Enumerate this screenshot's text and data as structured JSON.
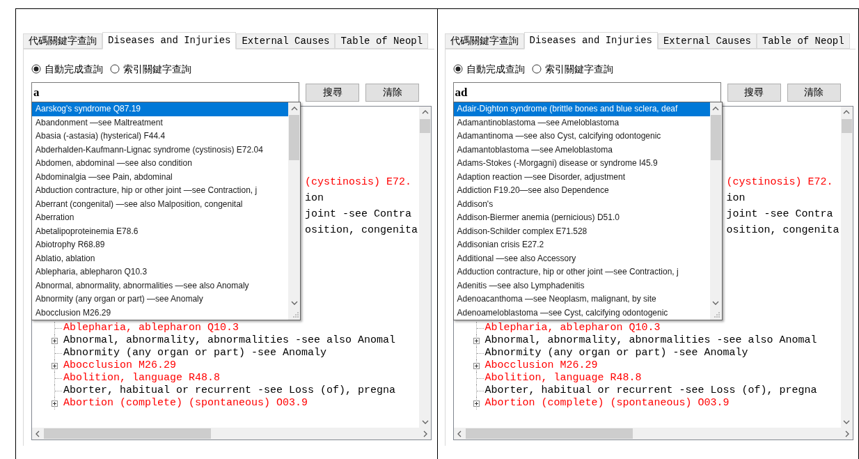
{
  "panels": [
    {
      "tabs": [
        {
          "label": "代碼關鍵字查詢",
          "selected": false
        },
        {
          "label": "Diseases and Injuries",
          "selected": true
        },
        {
          "label": "External Causes",
          "selected": false
        },
        {
          "label": "Table of Neopl",
          "selected": false
        }
      ],
      "radios": [
        {
          "label": "自動完成查詢",
          "selected": true
        },
        {
          "label": "索引關鍵字查詢",
          "selected": false
        }
      ],
      "search": {
        "value": "a"
      },
      "buttons": [
        "搜尋",
        "清除"
      ],
      "suggestions": [
        {
          "text": "Aarskog's syndrome  Q87.19",
          "selected": true
        },
        {
          "text": "Abandonment  —see Maltreatment",
          "selected": false
        },
        {
          "text": "Abasia (-astasia) (hysterical) F44.4",
          "selected": false
        },
        {
          "text": "Abderhalden-Kaufmann-Lignac syndrome (cystinosis) E72.04",
          "selected": false
        },
        {
          "text": "Abdomen, abdominal  —see also condition",
          "selected": false
        },
        {
          "text": "Abdominalgia  —see Pain, abdominal",
          "selected": false
        },
        {
          "text": "Abduction contracture, hip or other joint  —see Contraction, j",
          "selected": false
        },
        {
          "text": "Aberrant (congenital) —see also Malposition, congenital",
          "selected": false
        },
        {
          "text": "Aberration",
          "selected": false
        },
        {
          "text": "Abetalipoproteinemia  E78.6",
          "selected": false
        },
        {
          "text": "Abiotrophy  R68.89",
          "selected": false
        },
        {
          "text": "Ablatio, ablation",
          "selected": false
        },
        {
          "text": "Ablepharia, ablepharon  Q10.3",
          "selected": false
        },
        {
          "text": "Abnormal, abnormality, abnormalities  —see also Anomaly",
          "selected": false
        },
        {
          "text": "Abnormity (any organ or part) —see Anomaly",
          "selected": false
        },
        {
          "text": "Abocclusion  M26.29",
          "selected": false
        }
      ],
      "tree_fragments": [
        {
          "text": "(cystinosis) E72.",
          "color": "#ff0000"
        },
        {
          "text": "ion",
          "color": "#000000"
        },
        {
          "text": "joint  -see Contra",
          "color": "#000000"
        },
        {
          "text": "osition, congenita",
          "color": "#000000"
        }
      ],
      "tree_rows": [
        {
          "text": "Ablepharia, ablepharon  Q10.3",
          "color": "#ff0000",
          "expandable": false
        },
        {
          "text": "Abnormal, abnormality, abnormalities  -see also Anomal",
          "color": "#000000",
          "expandable": true
        },
        {
          "text": "Abnormity (any organ or part) -see Anomaly",
          "color": "#000000",
          "expandable": false
        },
        {
          "text": "Abocclusion  M26.29",
          "color": "#ff0000",
          "expandable": true
        },
        {
          "text": "Abolition, language  R48.8",
          "color": "#ff0000",
          "expandable": false
        },
        {
          "text": "Aborter, habitual or recurrent  -see Loss (of), pregna",
          "color": "#000000",
          "expandable": false
        },
        {
          "text": "Abortion (complete) (spontaneous) O03.9",
          "color": "#ff0000",
          "expandable": true
        }
      ]
    },
    {
      "tabs": [
        {
          "label": "代碼關鍵字查詢",
          "selected": false
        },
        {
          "label": "Diseases and Injuries",
          "selected": true
        },
        {
          "label": "External Causes",
          "selected": false
        },
        {
          "label": "Table of Neopl",
          "selected": false
        }
      ],
      "radios": [
        {
          "label": "自動完成查詢",
          "selected": true
        },
        {
          "label": "索引關鍵字查詢",
          "selected": false
        }
      ],
      "search": {
        "value": "ad"
      },
      "buttons": [
        "搜尋",
        "清除"
      ],
      "suggestions": [
        {
          "text": "Adair-Dighton syndrome (brittle bones and blue sclera, deaf",
          "selected": true
        },
        {
          "text": "Adamantinoblastoma  —see Ameloblastoma",
          "selected": false
        },
        {
          "text": "Adamantinoma  —see also Cyst, calcifying odontogenic",
          "selected": false
        },
        {
          "text": "Adamantoblastoma  —see Ameloblastoma",
          "selected": false
        },
        {
          "text": "Adams-Stokes (-Morgagni) disease or syndrome I45.9",
          "selected": false
        },
        {
          "text": "Adaption reaction  —see Disorder, adjustment",
          "selected": false
        },
        {
          "text": "Addiction  F19.20—see also Dependence",
          "selected": false
        },
        {
          "text": "Addison's",
          "selected": false
        },
        {
          "text": "Addison-Biermer anemia (pernicious) D51.0",
          "selected": false
        },
        {
          "text": "Addison-Schilder complex  E71.528",
          "selected": false
        },
        {
          "text": "Addisonian crisis  E27.2",
          "selected": false
        },
        {
          "text": "Additional  —see also Accessory",
          "selected": false
        },
        {
          "text": "Adduction contracture, hip or other joint  —see Contraction, j",
          "selected": false
        },
        {
          "text": "Adenitis  —see also Lymphadenitis",
          "selected": false
        },
        {
          "text": "Adenoacanthoma  —see Neoplasm, malignant, by site",
          "selected": false
        },
        {
          "text": "Adenoameloblastoma  —see Cyst, calcifying odontogenic",
          "selected": false
        }
      ],
      "tree_fragments": [
        {
          "text": "(cystinosis) E72.",
          "color": "#ff0000"
        },
        {
          "text": "ion",
          "color": "#000000"
        },
        {
          "text": "joint  -see Contra",
          "color": "#000000"
        },
        {
          "text": "osition, congenita",
          "color": "#000000"
        }
      ],
      "tree_rows": [
        {
          "text": "Ablepharia, ablepharon  Q10.3",
          "color": "#ff0000",
          "expandable": false
        },
        {
          "text": "Abnormal, abnormality, abnormalities  -see also Anomal",
          "color": "#000000",
          "expandable": true
        },
        {
          "text": "Abnormity (any organ or part) -see Anomaly",
          "color": "#000000",
          "expandable": false
        },
        {
          "text": "Abocclusion  M26.29",
          "color": "#ff0000",
          "expandable": true
        },
        {
          "text": "Abolition, language  R48.8",
          "color": "#ff0000",
          "expandable": false
        },
        {
          "text": "Aborter, habitual or recurrent  -see Loss (of), pregna",
          "color": "#000000",
          "expandable": false
        },
        {
          "text": "Abortion (complete) (spontaneous) O03.9",
          "color": "#ff0000",
          "expandable": true
        }
      ]
    }
  ]
}
